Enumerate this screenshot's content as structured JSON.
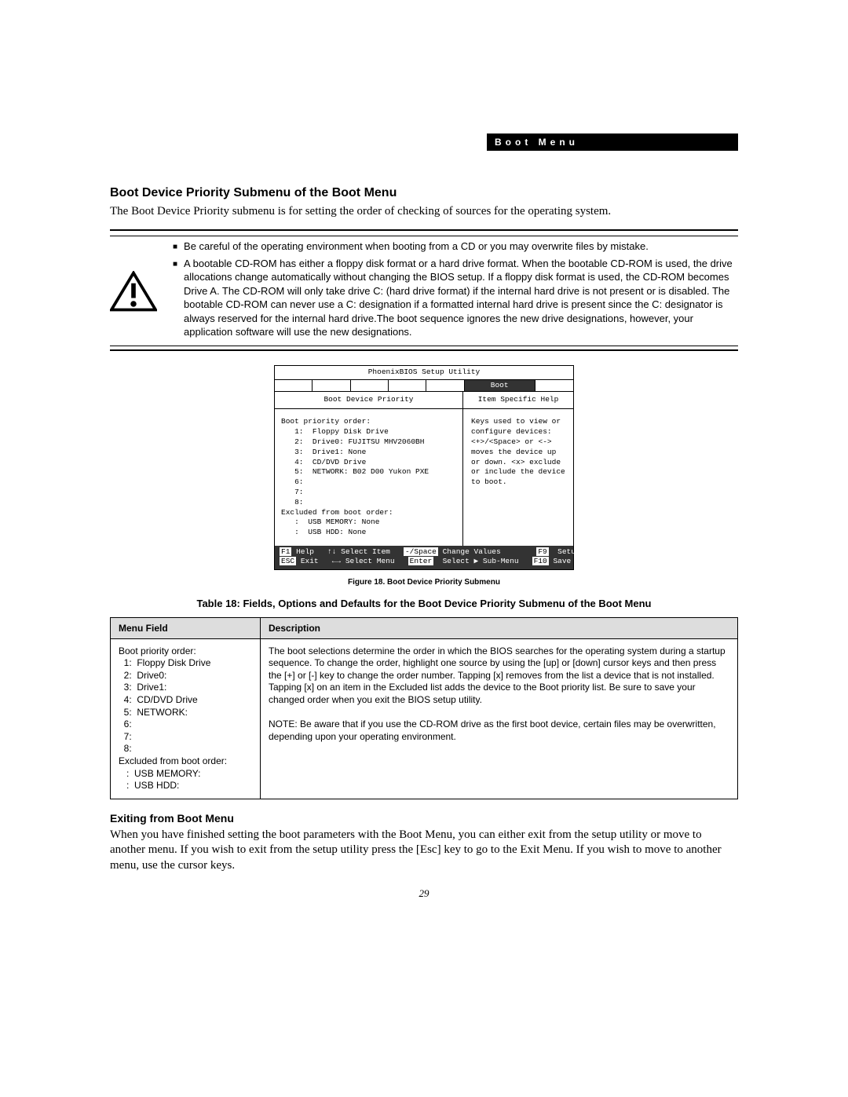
{
  "header_label": "Boot Menu",
  "section_title": "Boot Device Priority Submenu of the Boot Menu",
  "intro_text": "The Boot Device Priority submenu is for setting the order of checking of sources for the operating system.",
  "warnings": [
    "Be careful of the operating environment when booting from a CD or you may overwrite files by mistake.",
    "A bootable CD-ROM has either a floppy disk format or a hard drive format. When the bootable CD-ROM is used, the drive allocations change automatically without changing the BIOS setup. If a floppy disk format is used, the CD-ROM becomes Drive A. The CD-ROM will only take drive C: (hard drive format) if the internal hard drive is not present or is disabled. The bootable CD-ROM can never use a C: designation if a formatted internal hard drive is present since the C: designator is always reserved for the internal hard drive.The boot sequence ignores the new drive designations, however, your application software will use the new designations."
  ],
  "bios": {
    "utility_title": "PhoenixBIOS Setup Utility",
    "active_tab": "Boot",
    "left_header": "Boot Device Priority",
    "right_header": "Item Specific Help",
    "left_body": "Boot priority order:\n   1:  Floppy Disk Drive\n   2:  Drive0: FUJITSU MHV2060BH\n   3:  Drive1: None\n   4:  CD/DVD Drive\n   5:  NETWORK: B02 D00 Yukon PXE\n   6:\n   7:\n   8:\nExcluded from boot order:\n   :  USB MEMORY: None\n   :  USB HDD: None",
    "right_body": "Keys used to view or configure devices:\n\n<+>/<Space> or <->\nmoves the device up or down.\n<x> exclude or include the device to boot.",
    "footer_line1_parts": {
      "k1": "F1",
      "t1": "Help",
      "t2": "↑↓ Select Item",
      "k2": "-/Space",
      "t3": "Change Values",
      "k3": "F9",
      "t4": "Setup Defaults"
    },
    "footer_line2_parts": {
      "k1": "ESC",
      "t1": "Exit",
      "t2": "←→ Select Menu",
      "k2": "Enter",
      "t3": "Select ▶ Sub-Menu",
      "k3": "F10",
      "t4": "Save and Exit"
    }
  },
  "figure_caption": "Figure 18.  Boot Device Priority Submenu",
  "table_title": "Table 18: Fields, Options and Defaults for the Boot Device Priority Submenu of the Boot Menu",
  "table": {
    "headers": [
      "Menu Field",
      "Description"
    ],
    "rows": [
      {
        "field": "Boot priority order:\n  1:  Floppy Disk Drive\n  2:  Drive0:\n  3:  Drive1:\n  4:  CD/DVD Drive\n  5:  NETWORK:\n  6:\n  7:\n  8:\nExcluded from boot order:\n   :  USB MEMORY:\n   :  USB HDD:",
        "desc": "The boot selections determine the order in which the BIOS searches for the operating system during a startup sequence. To change the order, highlight one source by using the [up] or [down] cursor keys and then press the [+] or [-] key to change the order number. Tapping [x] removes from the list a device that is not installed. Tapping [x] on an item in the Excluded list adds the device to the Boot priority list. Be sure to save your changed order when you exit the BIOS setup utility.\n\nNOTE: Be aware that if you use the CD-ROM drive as the first boot device, certain files may be overwritten, depending upon your operating environment."
      }
    ]
  },
  "exit_title": "Exiting from Boot Menu",
  "exit_body": "When you have finished setting the boot parameters with the Boot Menu, you can either exit from the setup utility or move to another menu. If you wish to exit from the setup utility press the [Esc] key to go to the Exit Menu. If you wish to move to another menu, use the cursor keys.",
  "page_number": "29"
}
